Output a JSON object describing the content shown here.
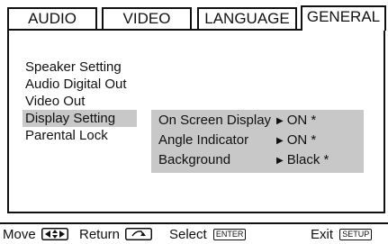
{
  "tabs": [
    {
      "label": "AUDIO",
      "active": false
    },
    {
      "label": "VIDEO",
      "active": false
    },
    {
      "label": "LANGUAGE",
      "active": false
    },
    {
      "label": "GENERAL",
      "active": true
    }
  ],
  "menu": {
    "items": [
      "Speaker Setting",
      "Audio Digital Out",
      "Video Out",
      "Display Setting",
      "Parental Lock"
    ],
    "selected_index": 3
  },
  "submenu": {
    "rows": [
      {
        "label": "On Screen Display",
        "value": "ON *"
      },
      {
        "label": "Angle Indicator",
        "value": "ON *"
      },
      {
        "label": "Background",
        "value": "Black *"
      }
    ]
  },
  "bottom_bar": {
    "move_label": "Move",
    "return_label": "Return",
    "select_label": "Select",
    "select_key": "ENTER",
    "exit_label": "Exit",
    "exit_key": "SETUP"
  },
  "icons": {
    "move": "four-way-arrow-icon",
    "return": "return-arrow-icon",
    "submenu_pointer": "triangle-right-icon"
  },
  "colors": {
    "highlight": "#c8c8c8",
    "border": "#111111"
  }
}
